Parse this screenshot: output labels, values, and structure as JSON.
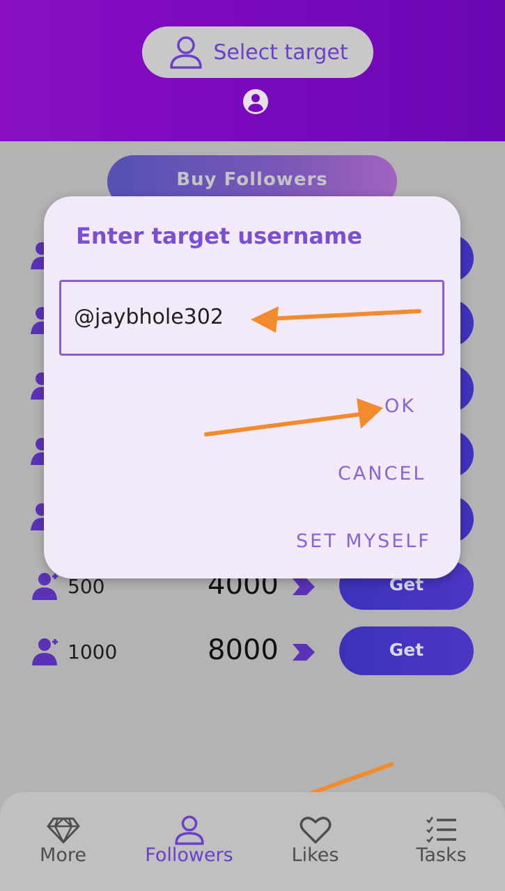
{
  "header": {
    "select_target_label": "Select target"
  },
  "buy_button": {
    "label": "Buy Followers"
  },
  "offers": [
    {
      "amount": "500",
      "cost": "4000",
      "button_label": "Get"
    },
    {
      "amount": "1000",
      "cost": "8000",
      "button_label": "Get"
    }
  ],
  "dialog": {
    "title": "Enter target username",
    "username_value": "@jaybhole302",
    "ok_label": "OK",
    "cancel_label": "CANCEL",
    "set_myself_label": "SET MYSELF"
  },
  "bottom_nav": [
    {
      "label": "More",
      "icon": "diamond-icon",
      "active": false
    },
    {
      "label": "Followers",
      "icon": "person-icon",
      "active": true
    },
    {
      "label": "Likes",
      "icon": "heart-icon",
      "active": false
    },
    {
      "label": "Tasks",
      "icon": "checklist-icon",
      "active": false
    }
  ],
  "colors": {
    "header": "#7a09bd",
    "accent": "#6a3fc9",
    "button": "#3c32b8",
    "dialog_bg": "#f2eaf8",
    "annotation_arrow": "#f28a2e"
  }
}
